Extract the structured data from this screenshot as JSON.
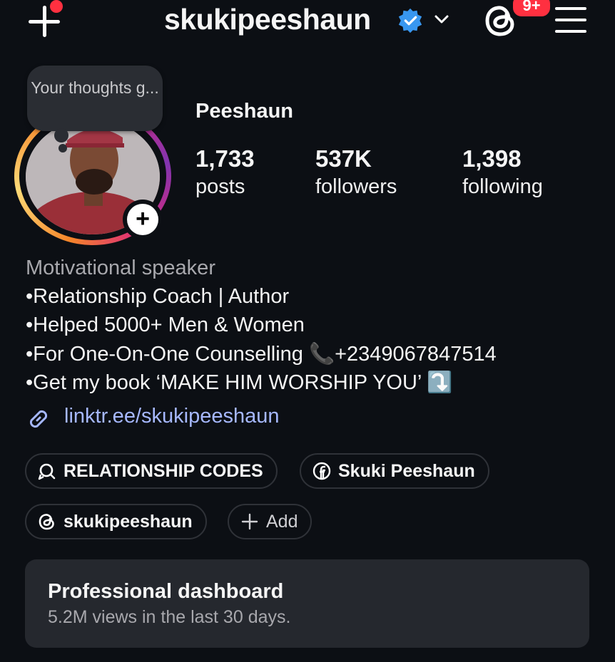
{
  "header": {
    "username": "skukipeeshaun",
    "threads_badge": "9+"
  },
  "note": {
    "text": "Your thoughts g..."
  },
  "profile": {
    "display_name": "Peeshaun",
    "stats": [
      {
        "value": "1,733",
        "label": "posts"
      },
      {
        "value": "537K",
        "label": "followers"
      },
      {
        "value": "1,398",
        "label": "following"
      }
    ]
  },
  "bio": {
    "category": "Motivational speaker",
    "lines": [
      "•Relationship Coach | Author",
      "•Helped 5000+ Men & Women",
      "•For One-On-One Counselling 📞+2349067847514",
      "•Get my book ‘MAKE HIM WORSHIP YOU’ ⤵️"
    ],
    "link": "linktr.ee/skukipeeshaun"
  },
  "pills": [
    {
      "label": "RELATIONSHIP CODES",
      "icon": "search-chat-icon"
    },
    {
      "label": "Skuki Peeshaun",
      "icon": "facebook-icon"
    },
    {
      "label": "skukipeeshaun",
      "icon": "threads-icon"
    },
    {
      "label": "Add",
      "icon": "plus-icon"
    }
  ],
  "dashboard": {
    "title": "Professional dashboard",
    "subtitle": "5.2M views in the last 30 days."
  },
  "colors": {
    "background": "#0c0f14",
    "accent_red": "#ff3040",
    "verified_blue": "#3897f0",
    "link_blue": "#a6b8ff"
  }
}
